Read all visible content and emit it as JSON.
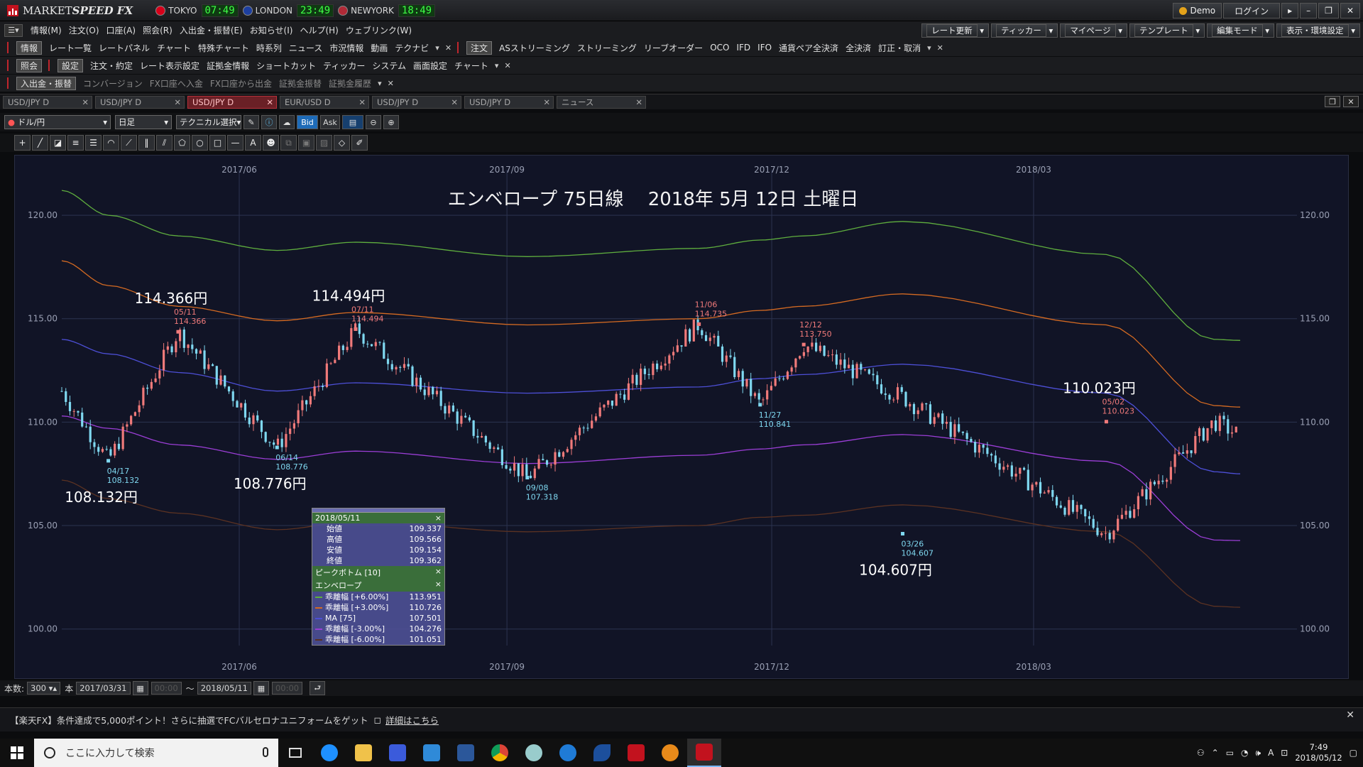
{
  "app": {
    "brand_main": "MARKET",
    "brand_bold": "SPEED FX"
  },
  "clocks": [
    {
      "city": "TOKYO",
      "time": "07:49",
      "flag": "#d7001a"
    },
    {
      "city": "LONDON",
      "time": "23:49",
      "flag": "#1d3fa0"
    },
    {
      "city": "NEWYORK",
      "time": "18:49",
      "flag": "#b02a37"
    }
  ],
  "account": {
    "mode": "Demo",
    "login": "ログイン"
  },
  "menu": [
    "情報(M)",
    "注文(O)",
    "口座(A)",
    "照会(R)",
    "入出金・振替(E)",
    "お知らせ(I)",
    "ヘルプ(H)",
    "ウェブリンク(W)"
  ],
  "menu_right": [
    "レート更新",
    "ティッカー",
    "マイページ",
    "テンプレート",
    "編集モード",
    "表示・環境設定"
  ],
  "toolbar1": {
    "group1_label": "情報",
    "group1": [
      "レート一覧",
      "レートパネル",
      "チャート",
      "特殊チャート",
      "時系列",
      "ニュース",
      "市況情報",
      "動画",
      "テクナビ"
    ],
    "group2_label": "注文",
    "group2": [
      "ASストリーミング",
      "ストリーミング",
      "リーブオーダー",
      "OCO",
      "IFD",
      "IFO",
      "通貨ペア全決済",
      "全決済",
      "訂正・取消"
    ]
  },
  "toolbar2": {
    "group1_label": "照会",
    "group2_label": "設定",
    "group2": [
      "注文・約定",
      "レート表示設定",
      "証拠金情報",
      "ショートカット",
      "ティッカー",
      "システム",
      "画面設定",
      "チャート"
    ]
  },
  "toolbar3": {
    "group1_label": "入出金・振替",
    "group1": [
      "コンバージョン",
      "FX口座へ入金",
      "FX口座から出金",
      "証拠金振替",
      "証拠金履歴"
    ]
  },
  "tabs": [
    "USD/JPY D",
    "USD/JPY D",
    "USD/JPY D",
    "EUR/USD D",
    "USD/JPY D",
    "USD/JPY D",
    "ニュース"
  ],
  "active_tab": 2,
  "controls": {
    "pair": "ドル/円",
    "period": "日足",
    "technical": "テクニカル選択",
    "bid": "Bid",
    "ask": "Ask"
  },
  "chart_title": "エンベロープ 75日線　 2018年 5月 12日 土曜日",
  "chart_data": {
    "type": "line",
    "x_ticks": [
      "2017/06",
      "2017/09",
      "2017/12",
      "2018/03"
    ],
    "y_ticks": [
      "120.00",
      "115.00",
      "110.00",
      "105.00",
      "100.00"
    ],
    "ylim": [
      99.2,
      122.2
    ],
    "x": [
      "2017-04-01",
      "2017-04-17",
      "2017-05-11",
      "2017-06-14",
      "2017-07-11",
      "2017-09-08",
      "2017-11-06",
      "2017-11-27",
      "2017-12-12",
      "2018-01-15",
      "2018-03-26",
      "2018-05-02",
      "2018-05-11"
    ],
    "series": [
      {
        "name": "乖離幅 [+6.00%]",
        "color": "#5fae3e",
        "values": [
          121.2,
          120.0,
          119.0,
          118.3,
          118.7,
          118.0,
          118.4,
          118.8,
          119.0,
          119.7,
          118.1,
          114.0,
          113.951
        ]
      },
      {
        "name": "乖離幅 [+3.00%]",
        "color": "#d46a22",
        "values": [
          117.8,
          116.6,
          115.6,
          114.9,
          115.3,
          114.7,
          115.0,
          115.4,
          115.6,
          116.2,
          114.7,
          110.8,
          110.726
        ]
      },
      {
        "name": "MA [75]",
        "color": "#4d4fd6",
        "values": [
          114.0,
          113.3,
          112.4,
          111.5,
          111.9,
          111.4,
          111.7,
          112.1,
          112.3,
          112.8,
          111.4,
          107.6,
          107.501
        ]
      },
      {
        "name": "乖離幅 [-3.00%]",
        "color": "#9b3ed6",
        "values": [
          110.3,
          109.7,
          108.9,
          108.2,
          108.6,
          108.0,
          108.4,
          108.7,
          108.9,
          109.4,
          108.1,
          104.3,
          104.276
        ]
      },
      {
        "name": "乖離幅 [-6.00%]",
        "color": "#5b3222",
        "values": [
          107.2,
          106.3,
          105.6,
          104.8,
          105.2,
          104.7,
          105.0,
          105.4,
          105.5,
          106.0,
          104.7,
          101.1,
          101.051
        ]
      }
    ],
    "price_path": {
      "x": [
        "2017-04-01",
        "2017-04-17",
        "2017-05-11",
        "2017-06-14",
        "2017-07-11",
        "2017-09-08",
        "2017-11-06",
        "2017-11-27",
        "2017-12-12",
        "2018-01-15",
        "2018-03-26",
        "2018-05-02",
        "2018-05-11"
      ],
      "values": [
        111.5,
        108.132,
        114.366,
        108.776,
        114.494,
        107.318,
        114.735,
        110.841,
        113.75,
        111.2,
        104.607,
        110.023,
        109.362
      ]
    },
    "annotations": [
      {
        "date": "04/17",
        "value": "108.132",
        "big": "108.132円",
        "pos": "below"
      },
      {
        "date": "05/11",
        "value": "114.366",
        "big": "114.366円",
        "pos": "above"
      },
      {
        "date": "06/14",
        "value": "108.776",
        "big": "108.776円",
        "pos": "below"
      },
      {
        "date": "07/11",
        "value": "114.494",
        "big": "114.494円",
        "pos": "above"
      },
      {
        "date": "09/08",
        "value": "107.318",
        "big": "",
        "pos": "below"
      },
      {
        "date": "11/06",
        "value": "114.735",
        "big": "",
        "pos": "above"
      },
      {
        "date": "11/27",
        "value": "110.841",
        "big": "",
        "pos": "below"
      },
      {
        "date": "12/12",
        "value": "113.750",
        "big": "",
        "pos": "above"
      },
      {
        "date": "03/26",
        "value": "104.607",
        "big": "104.607円",
        "pos": "below"
      },
      {
        "date": "05/02",
        "value": "110.023",
        "big": "110.023円",
        "pos": "above"
      }
    ]
  },
  "info_panel": {
    "date": "2018/05/11",
    "ohlc": [
      {
        "k": "始値",
        "v": "109.337"
      },
      {
        "k": "高値",
        "v": "109.566"
      },
      {
        "k": "安値",
        "v": "109.154"
      },
      {
        "k": "終値",
        "v": "109.362"
      }
    ],
    "peak_header": "ピークボトム [10]",
    "env_header": "エンベロープ",
    "env": [
      {
        "k": "乖離幅 [+6.00%]",
        "v": "113.951",
        "c": "#5fae3e"
      },
      {
        "k": "乖離幅 [+3.00%]",
        "v": "110.726",
        "c": "#d46a22"
      },
      {
        "k": "MA [75]",
        "v": "107.501",
        "c": "#4d4fd6"
      },
      {
        "k": "乖離幅 [-3.00%]",
        "v": "104.276",
        "c": "#9b3ed6"
      },
      {
        "k": "乖離幅 [-6.00%]",
        "v": "101.051",
        "c": "#5b3222"
      }
    ]
  },
  "range": {
    "count_label": "本数:",
    "count": "300",
    "unit": "本",
    "from": "2017/03/31",
    "from_time": "00:00",
    "tilde": "～",
    "to": "2018/05/11",
    "to_time": "00:00"
  },
  "news": {
    "text": "【楽天FX】条件達成で5,000ポイント！さらに抽選でFCバルセロナユニフォームをゲット",
    "link": "詳細はこちら"
  },
  "taskbar": {
    "search": "ここに入力して検索",
    "time": "7:49",
    "date": "2018/05/12"
  }
}
